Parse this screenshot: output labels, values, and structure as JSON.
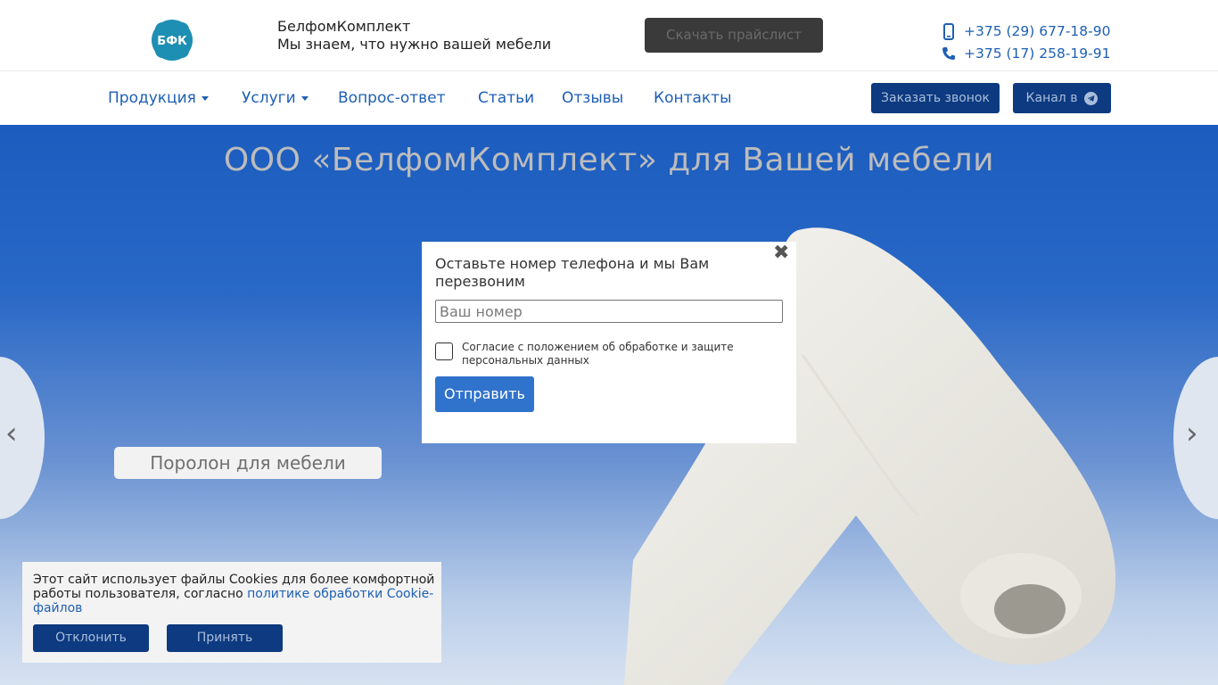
{
  "header": {
    "logo_text": "БФК",
    "brand_name": "БелфомКомплект",
    "tagline": "Мы знаем, что нужно вашей мебели",
    "price_button": "Скачать прайслист",
    "phones": [
      {
        "icon": "mobile-phone-icon",
        "number": "+375 (29) 677-18-90"
      },
      {
        "icon": "phone-handset-icon",
        "number": "+375 (17) 258-19-91"
      }
    ]
  },
  "nav": {
    "items": [
      {
        "label": "Продукция",
        "dropdown": true
      },
      {
        "label": "Услуги",
        "dropdown": true
      },
      {
        "label": "Вопрос-ответ",
        "dropdown": false
      },
      {
        "label": "Статьи",
        "dropdown": false
      },
      {
        "label": "Отзывы",
        "dropdown": false
      },
      {
        "label": "Контакты",
        "dropdown": false
      }
    ],
    "call_button": "Заказать звонок",
    "channel_button": "Канал в",
    "channel_icon": "telegram-icon"
  },
  "hero": {
    "title": "ООО «БелфомКомплект» для Вашей мебели",
    "slide_button": "Поролон для мебели",
    "prev_arrow": "‹",
    "next_arrow": "›"
  },
  "modal": {
    "title": "Оставьте номер телефона и мы Вам перезвоним",
    "phone_placeholder": "Ваш номер",
    "phone_value": "",
    "consent_label": "Согласие с положением об обработке и защите персональных данных",
    "consent_checked": false,
    "submit_button": "Отправить",
    "close_glyph": "✖"
  },
  "cookie": {
    "text": "Этот сайт использует файлы Cookies для более комфортной работы пользователя, согласно ",
    "link_text": "политике обработки Cookie-файлов",
    "decline_button": "Отклонить",
    "accept_button": "Принять"
  },
  "colors": {
    "accent": "#1e5fb4",
    "dark_button": "#0d3a80",
    "submit_button": "#3073cc",
    "hero_top": "#1b5cbe"
  }
}
